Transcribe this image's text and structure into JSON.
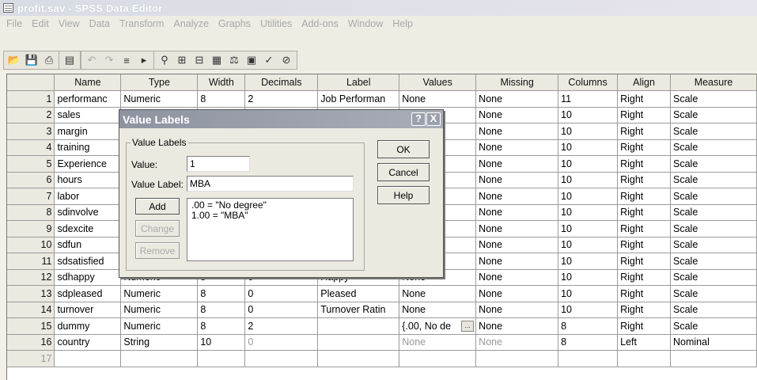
{
  "window": {
    "title": "profit.sav - SPSS Data Editor"
  },
  "menu": [
    "File",
    "Edit",
    "View",
    "Data",
    "Transform",
    "Analyze",
    "Graphs",
    "Utilities",
    "Add-ons",
    "Window",
    "Help"
  ],
  "toolbar": {
    "icons": [
      "open-icon",
      "save-icon",
      "print-icon",
      "dialog-recall-icon",
      "undo-icon",
      "redo-icon",
      "goto-case-icon",
      "variables-icon",
      "find-icon",
      "insert-cases-icon",
      "insert-variable-icon",
      "split-file-icon",
      "weight-cases-icon",
      "select-cases-icon",
      "value-labels-icon",
      "use-sets-icon"
    ]
  },
  "grid": {
    "columns": [
      "Name",
      "Type",
      "Width",
      "Decimals",
      "Label",
      "Values",
      "Missing",
      "Columns",
      "Align",
      "Measure"
    ],
    "rows": [
      [
        "1",
        "performanc",
        "Numeric",
        "8",
        "2",
        "Job Performan",
        "None",
        "None",
        "11",
        "Right",
        "Scale"
      ],
      [
        "2",
        "sales",
        "",
        "",
        "",
        "",
        "",
        "None",
        "10",
        "Right",
        "Scale"
      ],
      [
        "3",
        "margin",
        "",
        "",
        "",
        "",
        "",
        "None",
        "10",
        "Right",
        "Scale"
      ],
      [
        "4",
        "training",
        "",
        "",
        "",
        "",
        "",
        "None",
        "10",
        "Right",
        "Scale"
      ],
      [
        "5",
        "Experience",
        "",
        "",
        "",
        "",
        "",
        "None",
        "10",
        "Right",
        "Scale"
      ],
      [
        "6",
        "hours",
        "",
        "",
        "",
        "",
        "",
        "None",
        "10",
        "Right",
        "Scale"
      ],
      [
        "7",
        "labor",
        "",
        "",
        "",
        "",
        "",
        "None",
        "10",
        "Right",
        "Scale"
      ],
      [
        "8",
        "sdinvolve",
        "",
        "",
        "",
        "",
        "",
        "None",
        "10",
        "Right",
        "Scale"
      ],
      [
        "9",
        "sdexcite",
        "",
        "",
        "",
        "",
        "",
        "None",
        "10",
        "Right",
        "Scale"
      ],
      [
        "10",
        "sdfun",
        "",
        "",
        "",
        "",
        "",
        "None",
        "10",
        "Right",
        "Scale"
      ],
      [
        "11",
        "sdsatisfied",
        "",
        "",
        "",
        "",
        "",
        "None",
        "10",
        "Right",
        "Scale"
      ],
      [
        "12",
        "sdhappy",
        "Numeric",
        "8",
        "0",
        "Happy",
        "None",
        "None",
        "10",
        "Right",
        "Scale"
      ],
      [
        "13",
        "sdpleased",
        "Numeric",
        "8",
        "0",
        "Pleased",
        "None",
        "None",
        "10",
        "Right",
        "Scale"
      ],
      [
        "14",
        "turnover",
        "Numeric",
        "8",
        "0",
        "Turnover Ratin",
        "None",
        "None",
        "10",
        "Right",
        "Scale"
      ],
      [
        "15",
        "dummy",
        "Numeric",
        "8",
        "2",
        "",
        "{.00, No de",
        "None",
        "8",
        "Right",
        "Scale"
      ],
      [
        "16",
        "country",
        "String",
        "10",
        "0",
        "",
        "None",
        "None",
        "8",
        "Left",
        "Nominal"
      ],
      [
        "17",
        "",
        "",
        "",
        "",
        "",
        "",
        "",
        "",
        "",
        ""
      ]
    ]
  },
  "dialog": {
    "title": "Value Labels",
    "help_glyph": "?",
    "close_glyph": "X",
    "group_label": "Value Labels",
    "value_label": "Value:",
    "value": "1",
    "value_label_label": "Value Label:",
    "value_label_value": "MBA",
    "list": [
      ".00 = \"No degree\"",
      "1.00 = \"MBA\""
    ],
    "buttons": {
      "ok": "OK",
      "cancel": "Cancel",
      "help": "Help",
      "add": "Add",
      "change": "Change",
      "remove": "Remove"
    }
  }
}
